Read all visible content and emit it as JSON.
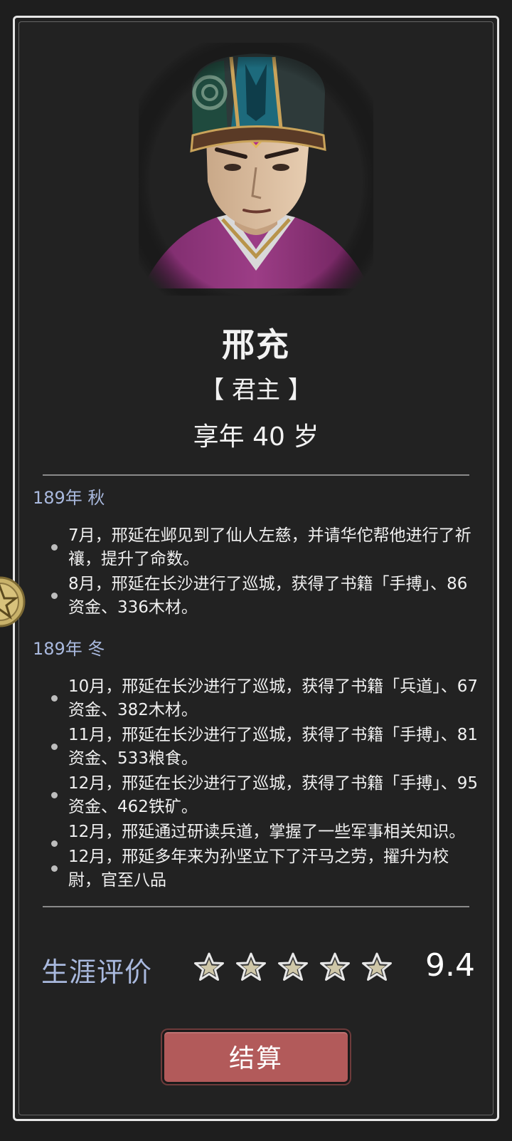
{
  "character": {
    "name": "邢充",
    "title": "【 君主 】",
    "age_text": "享年 40 岁"
  },
  "log": [
    {
      "season": "189年 秋",
      "entries": [
        "7月，邢延在邺见到了仙人左慈，并请华佗帮他进行了祈禳，提升了命数。",
        "8月，邢延在长沙进行了巡城，获得了书籍「手搏」、86资金、336木材。"
      ]
    },
    {
      "season": "189年 冬",
      "entries": [
        "10月，邢延在长沙进行了巡城，获得了书籍「兵道」、67资金、382木材。",
        "11月，邢延在长沙进行了巡城，获得了书籍「手搏」、81资金、533粮食。",
        "12月，邢延在长沙进行了巡城，获得了书籍「手搏」、95资金、462铁矿。",
        "12月，邢延通过研读兵道，掌握了一些军事相关知识。",
        "12月，邢延多年来为孙坚立下了汗马之劳，擢升为校尉，官至八品"
      ]
    }
  ],
  "rating": {
    "label": "生涯评价",
    "stars_filled": 5,
    "stars_total": 5,
    "score": "9.4"
  },
  "actions": {
    "settle_label": "结算"
  },
  "colors": {
    "background": "#1e1e1e",
    "panel": "#222222",
    "border": "#e6e6e6",
    "accent_blue": "#a9b9de",
    "button_red": "#b25a5a"
  },
  "icons": {
    "portrait": "general-portrait",
    "side_token": "pentagram-coin-icon",
    "star": "star-icon"
  }
}
